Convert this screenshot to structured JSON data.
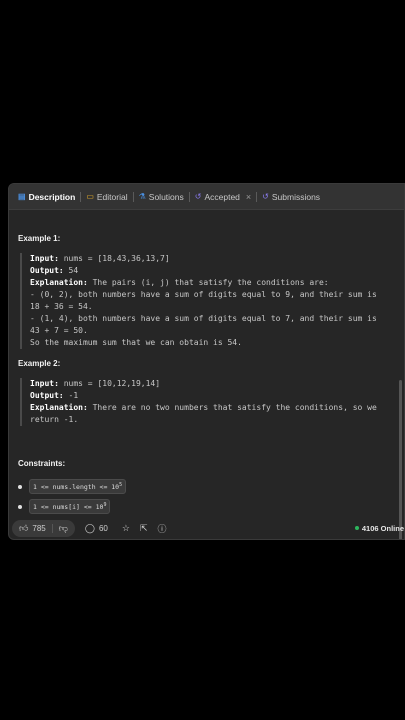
{
  "tabs": [
    {
      "label": "Description",
      "icon": "document-icon"
    },
    {
      "label": "Editorial",
      "icon": "book-icon"
    },
    {
      "label": "Solutions",
      "icon": "flask-icon"
    },
    {
      "label": "Accepted",
      "icon": "history-icon"
    },
    {
      "label": "Submissions",
      "icon": "history-icon"
    }
  ],
  "example1": {
    "heading": "Example 1:",
    "input_label": "Input:",
    "input_value": " nums = [18,43,36,13,7]",
    "output_label": "Output:",
    "output_value": " 54",
    "explanation_label": "Explanation:",
    "explanation_lines": [
      " The pairs (i, j) that satisfy the conditions are:",
      "- (0, 2), both numbers have a sum of digits equal to 9, and their sum is",
      "18 + 36 = 54.",
      "- (1, 4), both numbers have a sum of digits equal to 7, and their sum is",
      "43 + 7 = 50.",
      "So the maximum sum that we can obtain is 54."
    ]
  },
  "example2": {
    "heading": "Example 2:",
    "input_label": "Input:",
    "input_value": " nums = [10,12,19,14]",
    "output_label": "Output:",
    "output_value": " -1",
    "explanation_label": "Explanation:",
    "explanation_lines": [
      " There are no two numbers that satisfy the conditions, so we",
      "return -1."
    ]
  },
  "constraints": {
    "title": "Constraints:",
    "items": [
      {
        "text": "1 <= nums.length <= 10",
        "sup": "5"
      },
      {
        "text": "1 <= nums[i] <= 10",
        "sup": "9"
      }
    ]
  },
  "footer": {
    "likes": "785",
    "comments": "60",
    "online": "4106 Online"
  }
}
